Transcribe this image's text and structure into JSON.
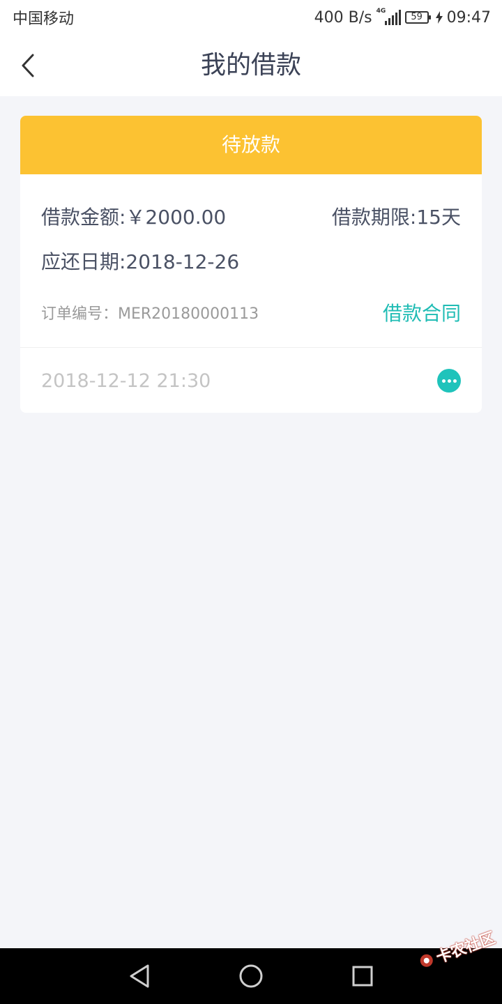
{
  "status_bar": {
    "carrier": "中国移动",
    "net_speed": "400 B/s",
    "network_tag": "4G",
    "battery_level": "59",
    "time": "09:47"
  },
  "nav": {
    "title": "我的借款"
  },
  "loan_card": {
    "status": "待放款",
    "amount": "借款金额:￥2000.00",
    "term": "借款期限:15天",
    "due_date": "应还日期:2018-12-26",
    "order_number": "订单编号：MER20180000113",
    "contract_link": "借款合同",
    "created_at": "2018-12-12 21:30"
  },
  "watermark": {
    "text": "卡农社区"
  },
  "colors": {
    "status_header": "#fcc232",
    "accent": "#1fbcb4",
    "page_background": "#f4f5f9"
  }
}
